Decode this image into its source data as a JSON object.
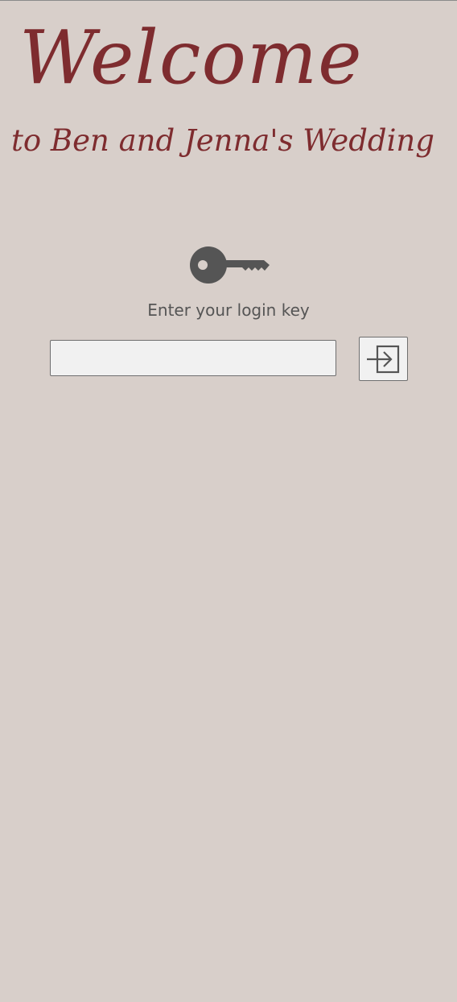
{
  "header": {
    "title": "Welcome",
    "subtitle": "to Ben and Jenna's Wedding"
  },
  "login": {
    "label": "Enter your login key",
    "input_value": "",
    "input_placeholder": "",
    "key_icon": "key-icon",
    "submit_icon": "login-icon"
  },
  "colors": {
    "background": "#d8cfca",
    "title": "#7e2c2f",
    "icon": "#555555"
  }
}
